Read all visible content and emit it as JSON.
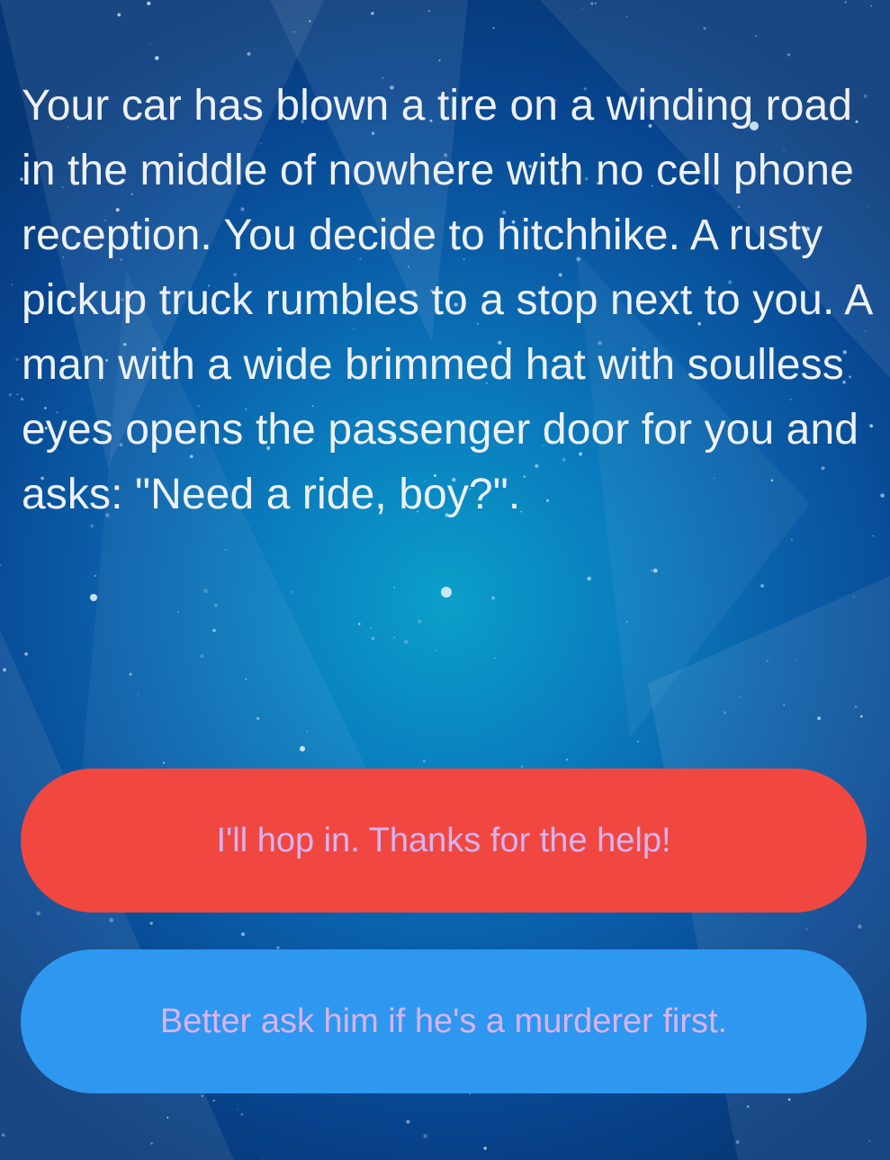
{
  "story": {
    "text": "Your car has blown a tire on a winding road in the middle of nowhere with no cell phone reception. You decide to hitchhike. A rusty pickup truck rumbles to a stop next to you. A man with a wide brimmed hat with soulless eyes opens the passenger door for you and asks: \"Need a ride, boy?\"."
  },
  "choices": [
    {
      "label": "I'll hop in. Thanks for the help!",
      "color": "#f04840"
    },
    {
      "label": "Better ask him if he's a murderer first.",
      "color": "#2e97f0"
    }
  ],
  "theme": {
    "text_color": "#eef1f6",
    "button_text_color": "#d9b3f0",
    "background_center": "#0b9fc8",
    "background_edge": "#063877"
  }
}
